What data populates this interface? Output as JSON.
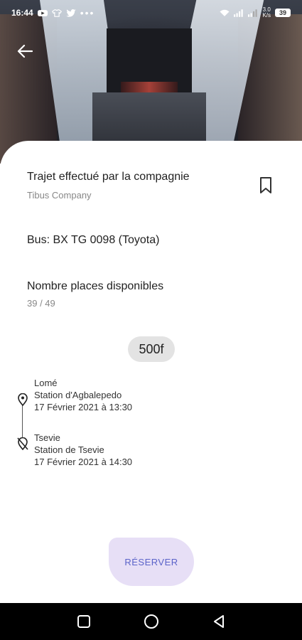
{
  "status_bar": {
    "time": "16:44",
    "icons": [
      "youtube-icon",
      "tshirt-icon",
      "twitter-icon",
      "more-dots-icon"
    ],
    "dots": "•••",
    "network_speed_top": "3.0",
    "network_speed_bottom": "K/s",
    "battery": "39"
  },
  "header": {
    "back_icon": "arrow-left-icon"
  },
  "trip": {
    "company_title": "Trajet effectué par la compagnie",
    "company_name": "Tibus Company",
    "bookmark_icon": "bookmark-outline-icon",
    "bus": "Bus: BX TG 0098 (Toyota)",
    "seats_title": "Nombre places disponibles",
    "seats_count": "39 / 49",
    "price": "500f"
  },
  "route": {
    "departure": {
      "city": "Lomé",
      "station": "Station d'Agbalepedo",
      "datetime": "17 Février 2021 à 13:30",
      "icon": "location-pin-icon"
    },
    "arrival": {
      "city": "Tsevie",
      "station": "Station de Tsevie",
      "datetime": "17 Février 2021 à 14:30",
      "icon": "location-off-icon"
    }
  },
  "actions": {
    "reserve_label": "RÉSERVER",
    "accent_color": "#5b63c9",
    "button_bg": "#e7dff6"
  },
  "navigation_bar": {
    "buttons": [
      "recents-square-icon",
      "home-circle-icon",
      "back-triangle-icon"
    ]
  }
}
